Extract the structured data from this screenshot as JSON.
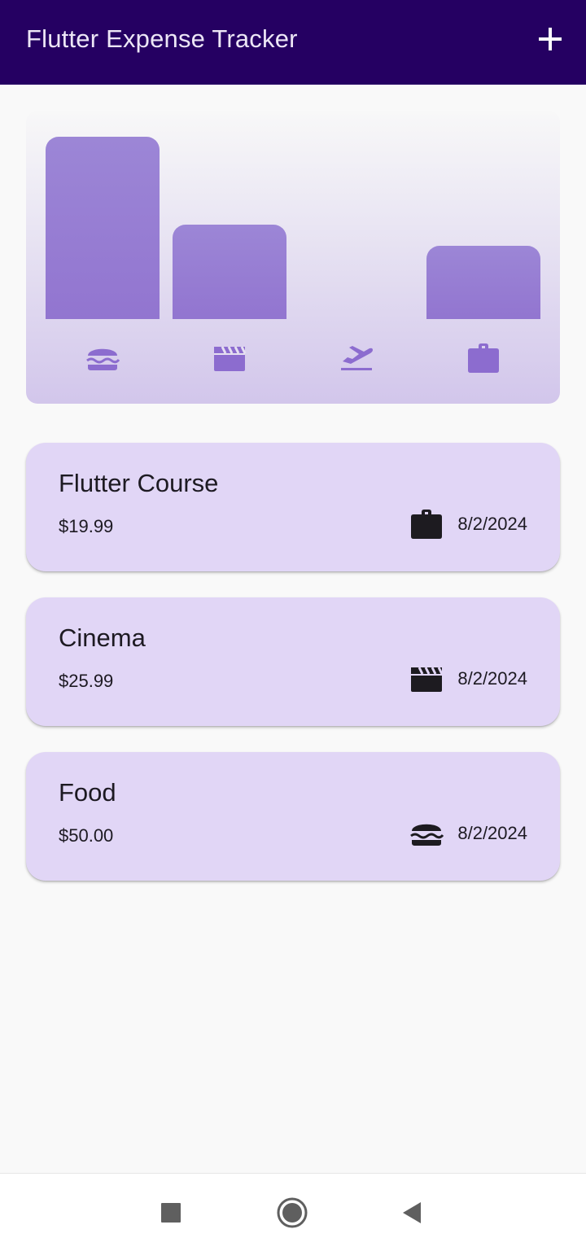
{
  "app_bar": {
    "title": "Flutter Expense Tracker",
    "add_icon": "plus-icon"
  },
  "chart": {
    "bar_color": "#9680d3",
    "icon_color": "#8c6ccf",
    "bucket_fill": [
      {
        "category": "food",
        "icon": "hamburger-icon",
        "fill": 1.0
      },
      {
        "category": "leisure",
        "icon": "clapperboard-icon",
        "fill": 0.52
      },
      {
        "category": "travel",
        "icon": "flight-takeoff-icon",
        "fill": 0.0
      },
      {
        "category": "work",
        "icon": "briefcase-icon",
        "fill": 0.4
      }
    ]
  },
  "expenses": [
    {
      "title": "Flutter Course",
      "amount": "$19.99",
      "date": "8/2/2024",
      "icon": "briefcase-icon"
    },
    {
      "title": "Cinema",
      "amount": "$25.99",
      "date": "8/2/2024",
      "icon": "clapperboard-icon"
    },
    {
      "title": "Food",
      "amount": "$50.00",
      "date": "8/2/2024",
      "icon": "hamburger-icon"
    }
  ],
  "nav_bar": {
    "recents_icon": "square-icon",
    "home_icon": "circle-icon",
    "back_icon": "triangle-back-icon"
  },
  "colors": {
    "app_bar": "#250062",
    "card": "#e1d6f6",
    "text": "#1d1a22"
  }
}
